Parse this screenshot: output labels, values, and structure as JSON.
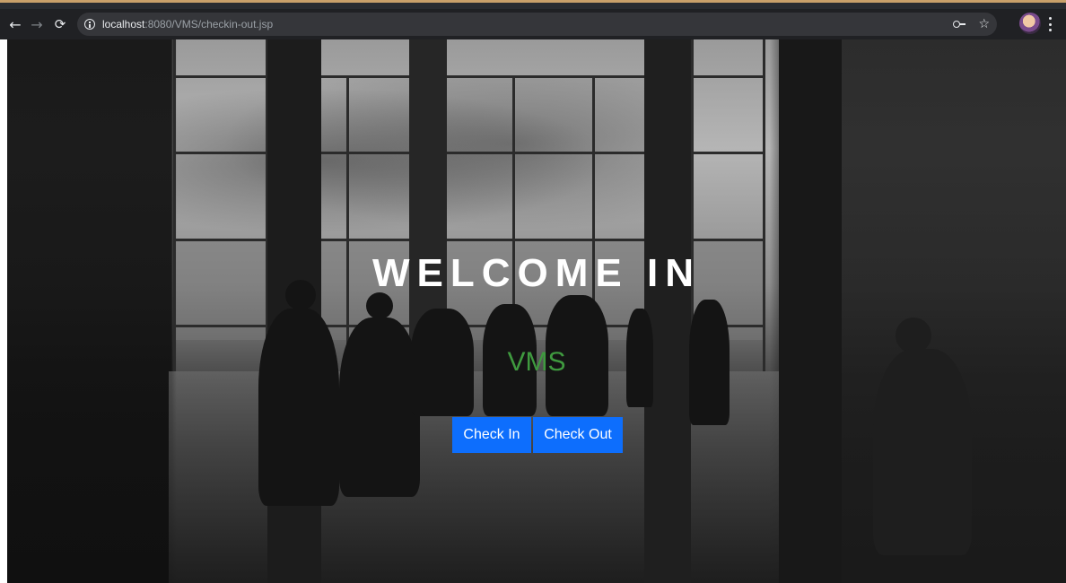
{
  "browser": {
    "url_host": "localhost",
    "url_rest": ":8080/VMS/checkin-out.jsp",
    "icons": {
      "back": "arrow-left-icon",
      "forward": "arrow-right-icon",
      "reload": "reload-icon",
      "site_info": "info-icon",
      "password": "key-icon",
      "bookmark": "star-icon",
      "profile": "avatar",
      "menu": "more-vertical-icon"
    }
  },
  "hero": {
    "title": "WELCOME IN",
    "subtitle": "VMS"
  },
  "actions": {
    "check_in_label": "Check In",
    "check_out_label": "Check Out"
  },
  "colors": {
    "button_primary": "#0d6efd",
    "subtitle_green": "#3f9a3f",
    "title_white": "#ffffff"
  }
}
